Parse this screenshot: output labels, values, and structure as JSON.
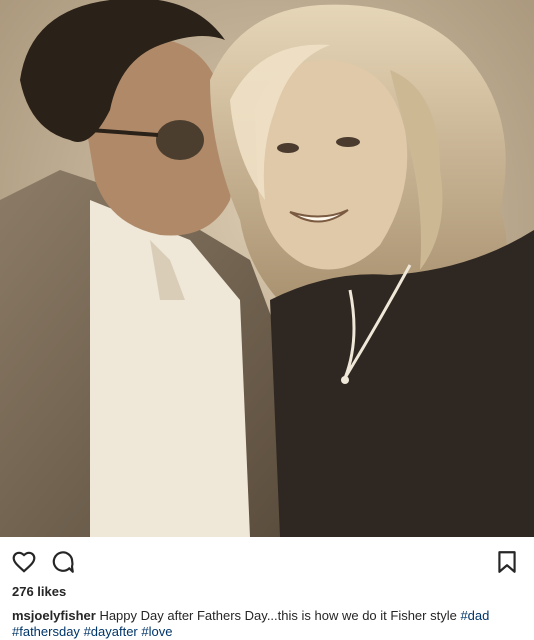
{
  "post": {
    "photo_alt": "Vintage sepia photo of a man in glasses kissing a smiling young woman",
    "likes": "276 likes",
    "caption": {
      "username": "msjoelyfisher",
      "text": " Happy Day after Fathers Day...this is how we do it Fisher style ",
      "tags": [
        "#dad",
        "#fathersday",
        "#dayafter",
        "#love"
      ]
    }
  },
  "icons": {
    "like": "heart-icon",
    "comment": "comment-icon",
    "save": "bookmark-icon"
  }
}
